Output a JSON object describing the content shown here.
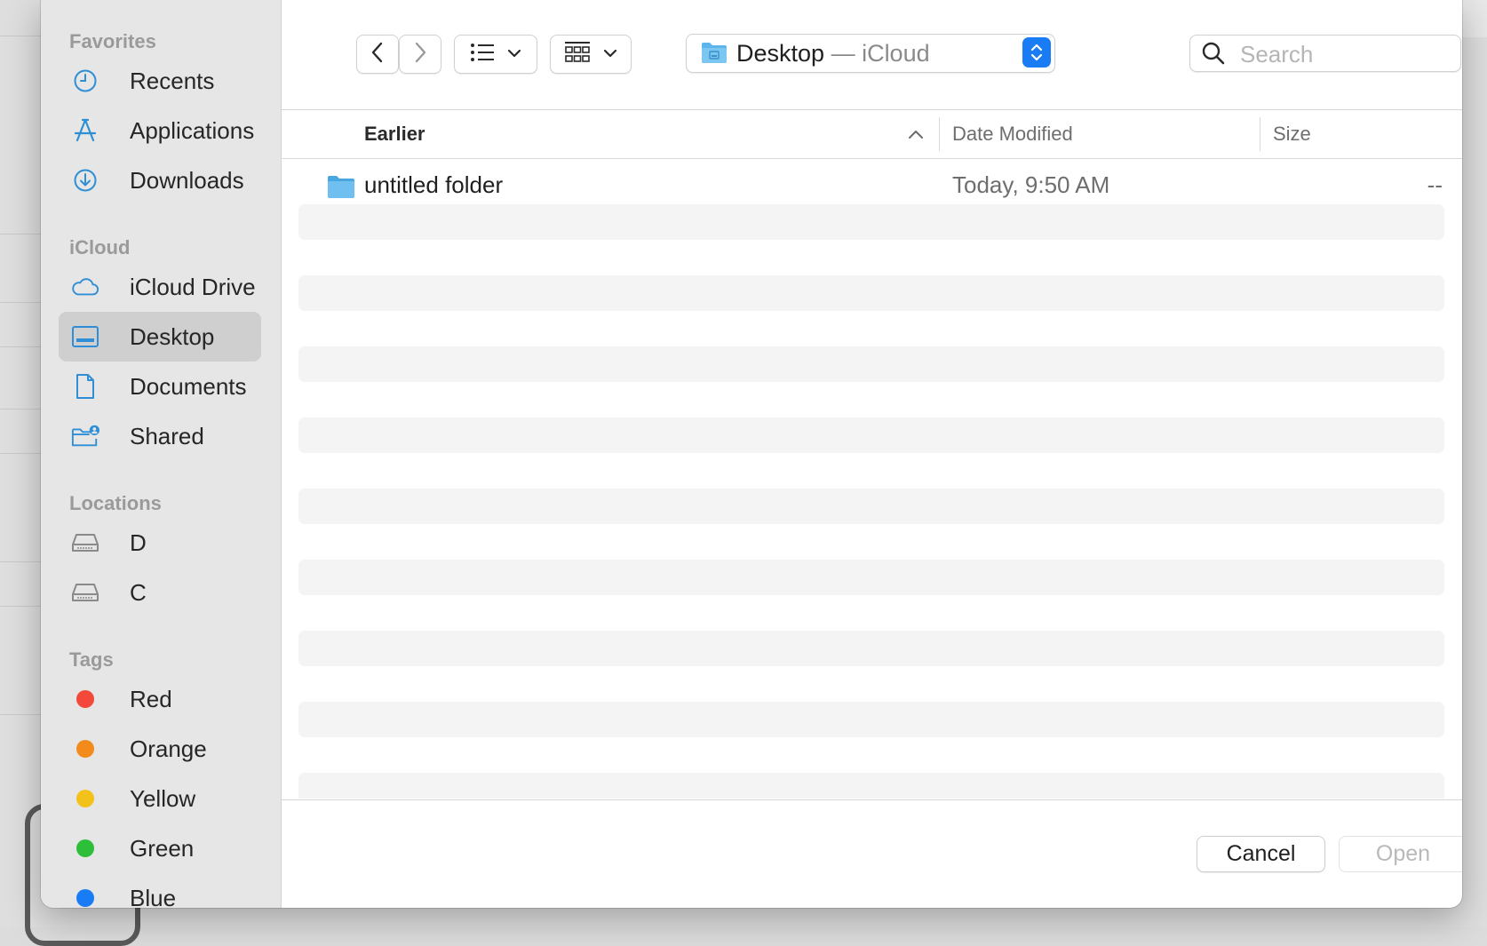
{
  "sidebar": {
    "favorites_title": "Favorites",
    "favorites": [
      {
        "label": "Recents",
        "icon": "clock-icon"
      },
      {
        "label": "Applications",
        "icon": "applications-icon"
      },
      {
        "label": "Downloads",
        "icon": "download-circle-icon"
      }
    ],
    "icloud_title": "iCloud",
    "icloud": [
      {
        "label": "iCloud Drive",
        "icon": "cloud-icon"
      },
      {
        "label": "Desktop",
        "icon": "desktop-icon",
        "selected": true
      },
      {
        "label": "Documents",
        "icon": "document-icon"
      },
      {
        "label": "Shared",
        "icon": "shared-folder-icon"
      }
    ],
    "locations_title": "Locations",
    "locations": [
      {
        "label": "D",
        "icon": "drive-icon"
      },
      {
        "label": "C",
        "icon": "drive-icon"
      }
    ],
    "tags_title": "Tags",
    "tags": [
      {
        "label": "Red",
        "color": "#f2493b"
      },
      {
        "label": "Orange",
        "color": "#f28a1c"
      },
      {
        "label": "Yellow",
        "color": "#f2c21a"
      },
      {
        "label": "Green",
        "color": "#2dbf3a"
      },
      {
        "label": "Blue",
        "color": "#1a7cf5"
      }
    ]
  },
  "toolbar": {
    "back_icon": "chevron-left-icon",
    "forward_icon": "chevron-right-icon",
    "list_view_icon": "list-view-icon",
    "group_icon": "grid-group-icon",
    "location_name": "Desktop",
    "location_suffix": " — iCloud",
    "search_placeholder": "Search"
  },
  "columns": {
    "name": "Earlier",
    "date": "Date Modified",
    "size": "Size"
  },
  "files": [
    {
      "name": "untitled folder",
      "date": "Today, 9:50 AM",
      "size": "--",
      "icon": "folder-icon"
    }
  ],
  "footer": {
    "cancel": "Cancel",
    "open": "Open"
  },
  "colors": {
    "accent": "#1a7cf5",
    "folder": "#5cb6ec",
    "sidebar_icon": "#2e8fd6"
  }
}
